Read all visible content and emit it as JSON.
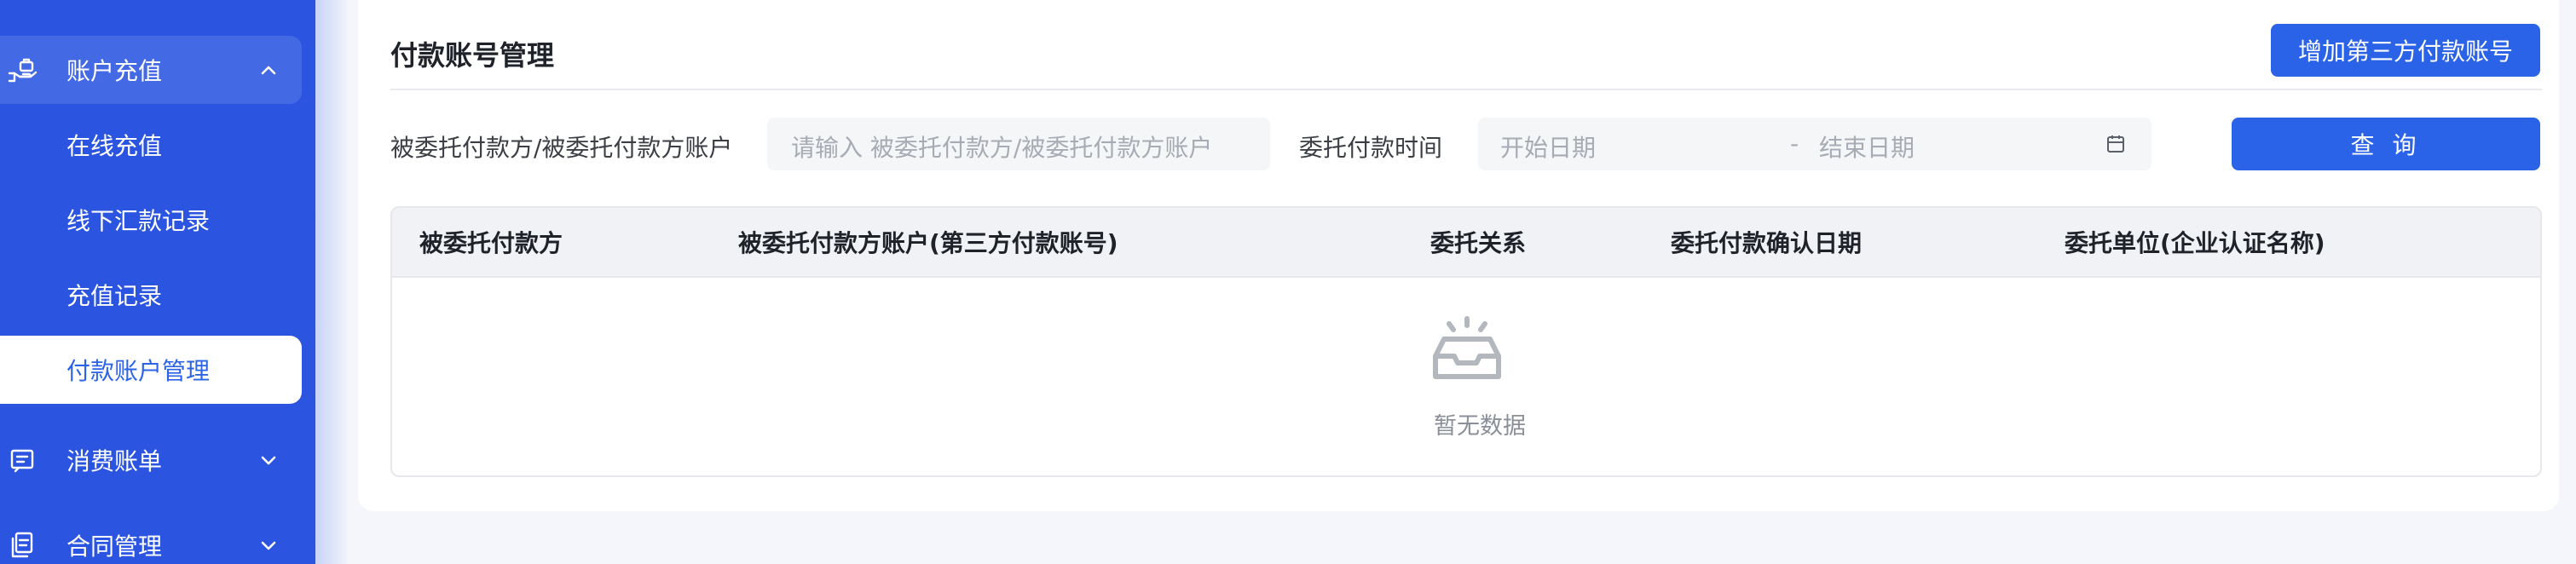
{
  "sidebar": {
    "groups": [
      {
        "label": "账户充值",
        "icon": "wallet-hand-icon",
        "expanded": true
      },
      {
        "label": "消费账单",
        "icon": "receipt-icon",
        "expanded": false
      },
      {
        "label": "合同管理",
        "icon": "document-copy-icon",
        "expanded": false
      }
    ],
    "sub_items": [
      {
        "label": "在线充值"
      },
      {
        "label": "线下汇款记录"
      },
      {
        "label": "充值记录"
      },
      {
        "label": "付款账户管理",
        "active": true
      }
    ],
    "colors": {
      "background": "#2b55e1",
      "active_text": "#2b63e8"
    }
  },
  "main": {
    "title": "付款账号管理",
    "add_button": "增加第三方付款账号",
    "filters": {
      "payer_label": "被委托付款方/被委托付款方账户",
      "payer_placeholder": "请输入 被委托付款方/被委托付款方账户",
      "date_label": "委托付款时间",
      "start_placeholder": "开始日期",
      "separator": "-",
      "end_placeholder": "结束日期",
      "calendar_icon": "calendar-icon"
    },
    "search_button": "查 询",
    "table": {
      "columns": [
        "被委托付款方",
        "被委托付款方账户(第三方付款账号)",
        "委托关系",
        "委托付款确认日期",
        "委托单位(企业认证名称)"
      ],
      "rows": [],
      "empty_text": "暂无数据",
      "empty_icon": "empty-inbox-icon"
    },
    "colors": {
      "primary": "#2b63e8"
    }
  }
}
